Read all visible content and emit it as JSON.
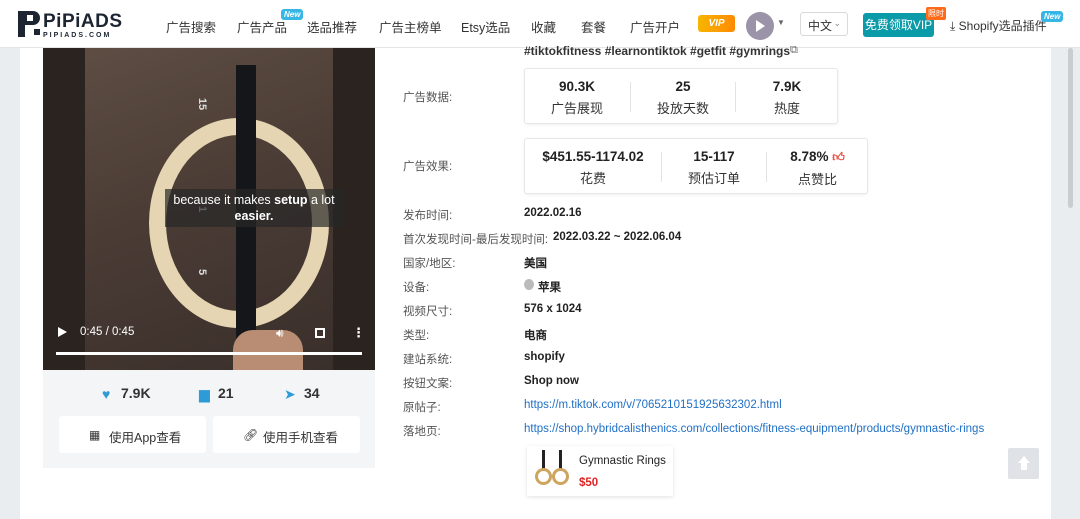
{
  "brand": {
    "name": "PiPiADS",
    "sub": "PIPIADS.COM"
  },
  "nav": {
    "items": [
      {
        "label": "广告搜索",
        "new": false
      },
      {
        "label": "广告产品",
        "new": true
      },
      {
        "label": "选品推荐",
        "new": false
      },
      {
        "label": "广告主榜单",
        "new": false
      },
      {
        "label": "Etsy选品",
        "new": false
      },
      {
        "label": "收藏",
        "new": false
      },
      {
        "label": "套餐",
        "new": false
      },
      {
        "label": "广告开户",
        "new": false
      }
    ],
    "new_badge": "New",
    "vip_icon_text": "VIP",
    "language": "中文",
    "vip_button": "免费领取VIP",
    "limited_badge": "限时",
    "plugin_label": "Shopify选品插件",
    "plugin_badge": "New"
  },
  "video": {
    "caption_line1_pre": "because it makes ",
    "caption_line1_bold": "setup",
    "caption_line1_post": " a lot",
    "caption_line2": "easier.",
    "time": "0:45 / 0:45",
    "strap_numbers": [
      "15",
      "1",
      "5"
    ],
    "progress": 1.0
  },
  "engagement": {
    "likes": "7.9K",
    "comments": "21",
    "shares": "34"
  },
  "buttons": {
    "app_view": "使用App查看",
    "phone_view": "使用手机查看"
  },
  "details": {
    "hashtags": "#tiktokfitness #learnontiktok #getfit #gymrings",
    "ad_data_label": "广告数据:",
    "ad_data": [
      {
        "value": "90.3K",
        "label": "广告展现"
      },
      {
        "value": "25",
        "label": "投放天数"
      },
      {
        "value": "7.9K",
        "label": "热度"
      }
    ],
    "ad_effect_label": "广告效果:",
    "ad_effect": [
      {
        "value": "$451.55-1174.02",
        "label": "花费"
      },
      {
        "value": "15-117",
        "label": "预估订单"
      },
      {
        "value": "8.78%",
        "label": "点赞比"
      }
    ],
    "rows": [
      {
        "label": "发布时间:",
        "value": "2022.02.16"
      },
      {
        "label": "首次发现时间-最后发现时间:",
        "value": "2022.03.22 ~ 2022.06.04"
      },
      {
        "label": "国家/地区:",
        "value": "美国"
      },
      {
        "label": "设备:",
        "value": "苹果"
      },
      {
        "label": "视频尺寸:",
        "value": "576 x 1024"
      },
      {
        "label": "类型:",
        "value": "电商"
      },
      {
        "label": "建站系统:",
        "value": "shopify"
      },
      {
        "label": "按钮文案:",
        "value": "Shop now"
      },
      {
        "label": "原帖子:",
        "value": "https://m.tiktok.com/v/7065210151925632302.html"
      },
      {
        "label": "落地页:",
        "value": "https://shop.hybridcalisthenics.com/collections/fitness-equipment/products/gymnastic-rings"
      }
    ]
  },
  "product": {
    "name": "Gymnastic Rings",
    "price": "$50"
  },
  "colors": {
    "accent": "#0b9aa8",
    "link": "#1f6fc5",
    "price": "#e02424",
    "heart": "#2e9bd6"
  }
}
